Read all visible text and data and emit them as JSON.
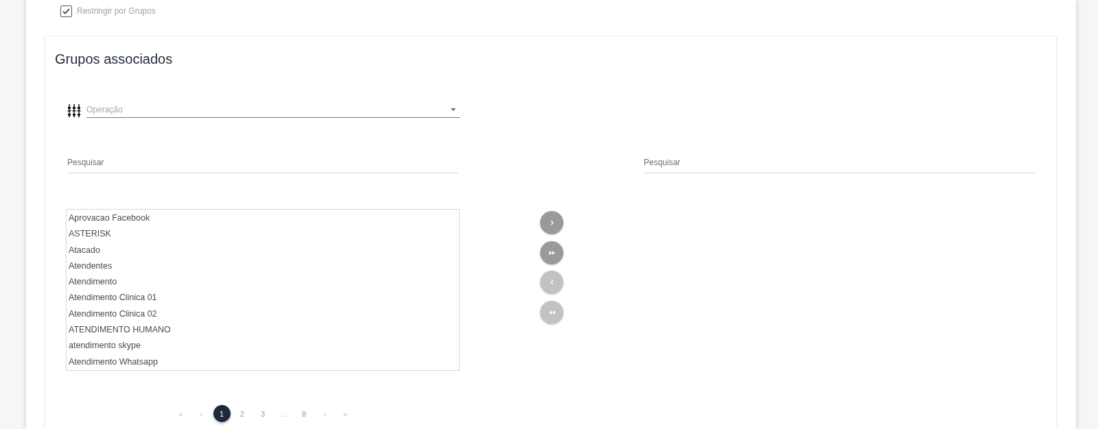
{
  "restrict_groups": {
    "label": "Restringir por Grupos",
    "checked": true
  },
  "card": {
    "title": "Grupos associados",
    "operation_select": {
      "placeholder": "Operação"
    },
    "available": {
      "search": {
        "placeholder": "Pesquisar"
      },
      "items": [
        "Aprovacao Facebook",
        "ASTERISK",
        "Atacado",
        "Atendentes",
        "Atendimento",
        "Atendimento Clinica 01",
        "Atendimento Clinica 02",
        "ATENDIMENTO HUMANO",
        "atendimento skype",
        "Atendimento Whatsapp"
      ]
    },
    "transfer_buttons": [
      {
        "kind": "move_selected_right",
        "disabled": false
      },
      {
        "kind": "move_all_right",
        "disabled": false
      },
      {
        "kind": "move_selected_left",
        "disabled": true
      },
      {
        "kind": "move_all_left",
        "disabled": true
      }
    ],
    "associated": {
      "search": {
        "placeholder": "Pesquisar"
      }
    },
    "pagination": [
      {
        "kind": "first",
        "label": "«",
        "selected": false
      },
      {
        "kind": "prev",
        "label": "‹",
        "selected": false
      },
      {
        "kind": "page",
        "label": "1",
        "selected": true
      },
      {
        "kind": "page",
        "label": "2",
        "selected": false
      },
      {
        "kind": "page",
        "label": "3",
        "selected": false
      },
      {
        "kind": "ellipsis",
        "label": "...",
        "selected": false
      },
      {
        "kind": "page",
        "label": "8",
        "selected": false
      },
      {
        "kind": "next",
        "label": "›",
        "selected": false
      },
      {
        "kind": "last",
        "label": "»",
        "selected": false
      }
    ]
  }
}
